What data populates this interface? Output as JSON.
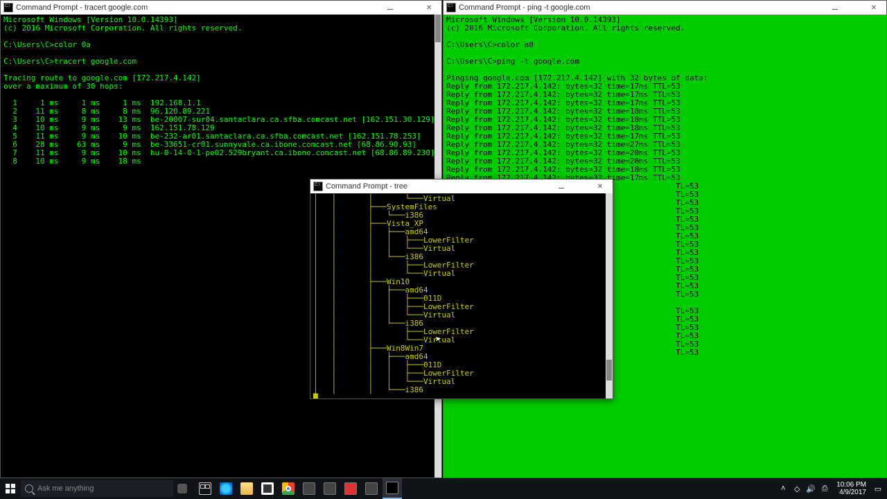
{
  "win1": {
    "title": "Command Prompt - tracert  google.com",
    "body": "Microsoft Windows [Version 10.0.14393]\n(c) 2016 Microsoft Corporation. All rights reserved.\n\nC:\\Users\\C>color 0a\n\nC:\\Users\\C>tracert google.com\n\nTracing route to google.com [172.217.4.142]\nover a maximum of 30 hops:\n\n  1     1 ms     1 ms     1 ms  192.168.1.1\n  2    11 ms     8 ms     8 ms  96.120.89.221\n  3    10 ms     9 ms    13 ms  be-20007-sur04.santaclara.ca.sfba.comcast.net [162.151.30.129]\n  4    10 ms     9 ms     9 ms  162.151.78.129\n  5    11 ms     9 ms    10 ms  be-232-ar01.santaclara.ca.sfba.comcast.net [162.151.78.253]\n  6    28 ms    63 ms     9 ms  be-33651-cr01.sunnyvale.ca.ibone.comcast.net [68.86.90.93]\n  7    11 ms     9 ms    10 ms  hu-0-14-0-1-pe02.529bryant.ca.ibone.comcast.net [68.86.89.230]\n  8    10 ms     9 ms    18 ms"
  },
  "win2": {
    "title": "Command Prompt - ping  -t google.com",
    "body": "Microsoft Windows [Version 10.0.14393]\n(c) 2016 Microsoft Corporation. All rights reserved.\n\nC:\\Users\\C>color a0\n\nC:\\Users\\C>ping -t google.com\n\nPinging google.com [172.217.4.142] with 32 bytes of data:\nReply from 172.217.4.142: bytes=32 time=17ms TTL=53\nReply from 172.217.4.142: bytes=32 time=17ms TTL=53\nReply from 172.217.4.142: bytes=32 time=17ms TTL=53\nReply from 172.217.4.142: bytes=32 time=18ms TTL=53\nReply from 172.217.4.142: bytes=32 time=18ms TTL=53\nReply from 172.217.4.142: bytes=32 time=18ms TTL=53\nReply from 172.217.4.142: bytes=32 time=17ms TTL=53\nReply from 172.217.4.142: bytes=32 time=27ms TTL=53\nReply from 172.217.4.142: bytes=32 time=20ms TTL=53\nReply from 172.217.4.142: bytes=32 time=20ms TTL=53\nReply from 172.217.4.142: bytes=32 time=18ms TTL=53\nReply from 172.217.4.142: bytes=32 time=17ms TTL=53\n                                                  TL=53\n                                                  TL=53\n                                                  TL=53\n                                                  TL=53\n                                                  TL=53\n                                                  TL=53\n                                                  TL=53\n                                                  TL=53\n                                                  TL=53\n                                                  TL=53\n                                                  TL=53\n                                                  TL=53\n                                                  TL=53\n                                                  TL=53\n\n                                                  TL=53\n                                                  TL=53\n                                                  TL=53\n                                                  TL=53\n                                                  TL=53\n                                                  TL=53"
  },
  "win3": {
    "title": "Command Prompt - tree",
    "body": "│   │       │       └───Virtual\n│   │       ├───SystemFiles\n│   │       │   └───i386\n│   │       ├───Vista_XP\n│   │       │   ├───amd64\n│   │       │   │   ├───LowerFilter\n│   │       │   │   └───Virtual\n│   │       │   └───i386\n│   │       │       ├───LowerFilter\n│   │       │       └───Virtual\n│   │       ├───Win10\n│   │       │   ├───amd64\n│   │       │   │   ├───011D\n│   │       │   │   ├───LowerFilter\n│   │       │   │   └───Virtual\n│   │       │   └───i386\n│   │       │       ├───LowerFilter\n│   │       │       └───Virtual\n│   │       ├───Win8Win7\n│   │       │   ├───amd64\n│   │       │   │   ├───011D\n│   │       │   │   ├───LowerFilter\n│   │       │   │   └───Virtual\n│   │       │   └───i386\n█"
  },
  "taskbar": {
    "search_placeholder": "Ask me anything",
    "time": "10:06 PM",
    "date": "4/9/2017"
  }
}
